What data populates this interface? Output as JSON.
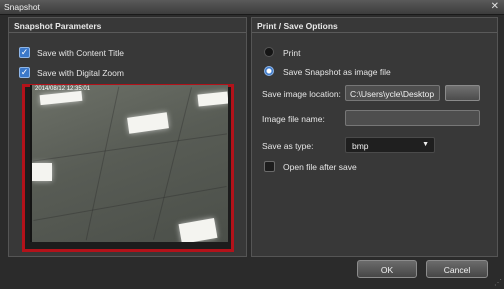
{
  "window": {
    "title": "Snapshot",
    "close_glyph": "✕"
  },
  "left_panel": {
    "title": "Snapshot Parameters",
    "options": [
      {
        "label": "Save with Content Title",
        "checked": true
      },
      {
        "label": "Save with Digital Zoom",
        "checked": true
      }
    ],
    "preview_overlay_text": "2014/08/12 12:35:01"
  },
  "right_panel": {
    "title": "Print / Save Options",
    "radio_print": {
      "label": "Print",
      "selected": false
    },
    "radio_save": {
      "label": "Save Snapshot as image file",
      "selected": true
    },
    "location": {
      "label": "Save image location:",
      "value": "C:\\Users\\ycle\\Desktop"
    },
    "filename": {
      "label": "Image file name:",
      "value": ""
    },
    "save_type": {
      "label": "Save as type:",
      "value": "bmp"
    },
    "open_after": {
      "label": "Open file after save",
      "checked": false
    }
  },
  "buttons": {
    "ok": "OK",
    "cancel": "Cancel"
  },
  "colors": {
    "highlight": "#b3121a",
    "accent": "#3b78c9"
  }
}
